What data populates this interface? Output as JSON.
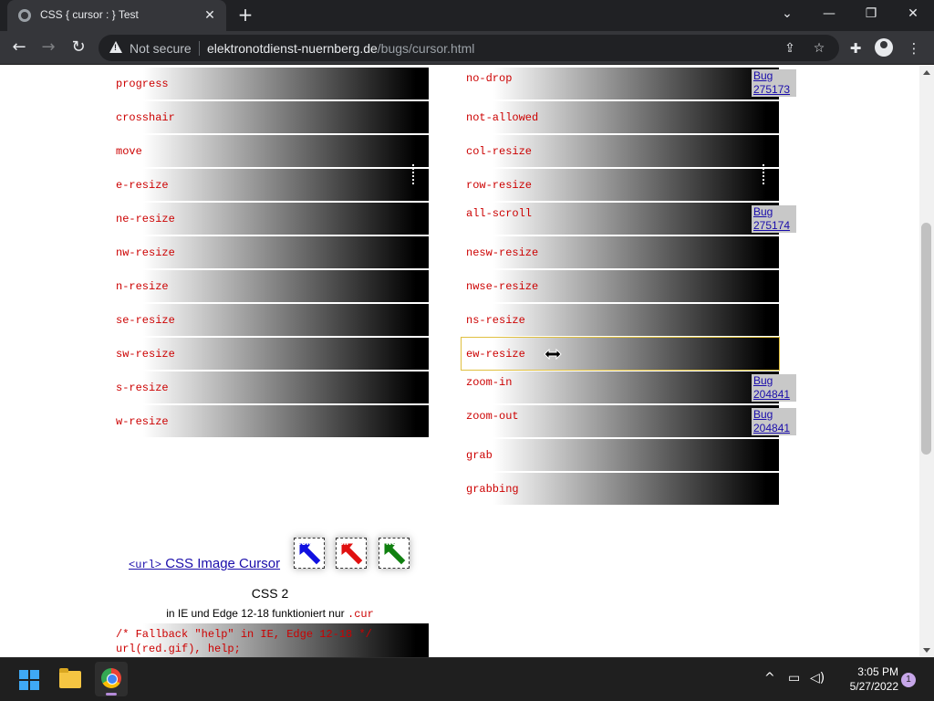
{
  "browser": {
    "tab_title": "CSS { cursor : } Test",
    "tab_close": "✕",
    "new_tab": "+",
    "minimize": "⌄",
    "win_min": "—",
    "win_restore": "❐",
    "win_close": "✕",
    "not_secure": "Not secure",
    "url_host": "elektronotdienst-nuernberg.de",
    "url_path": "/bugs/cursor.html"
  },
  "left_rows": [
    "progress",
    "crosshair",
    "move",
    "e-resize",
    "ne-resize",
    "nw-resize",
    "n-resize",
    "se-resize",
    "sw-resize",
    "s-resize",
    "w-resize"
  ],
  "right_rows": [
    "no-drop",
    "not-allowed",
    "col-resize",
    "row-resize",
    "all-scroll",
    "nesw-resize",
    "nwse-resize",
    "ns-resize",
    "ew-resize",
    "zoom-in",
    "zoom-out",
    "grab",
    "grabbing"
  ],
  "bugs": {
    "label": "Bug",
    "no_drop": "275173",
    "all_scroll": "275174",
    "zoom_in": "204841",
    "zoom_out": "204841"
  },
  "image_cursor": {
    "code": "<url>",
    "label": "CSS Image Cursor",
    "icons": [
      "CUR",
      "GIF",
      "PNG"
    ]
  },
  "css2": {
    "title": "CSS 2",
    "note": "in IE und Edge 12-18 funktioniert nur",
    "note_code": ".cur",
    "code_line1": "/* Fallback \"help\" in IE, Edge 12-18 */",
    "code_line2": "url(red.gif), help;"
  },
  "taskbar": {
    "time": "3:05 PM",
    "date": "5/27/2022",
    "notifications": "1"
  },
  "colors": {
    "cursor_name": "#cc0000",
    "cur_icon": "#1010e0",
    "gif_icon": "#e01010",
    "png_icon": "#108010"
  }
}
